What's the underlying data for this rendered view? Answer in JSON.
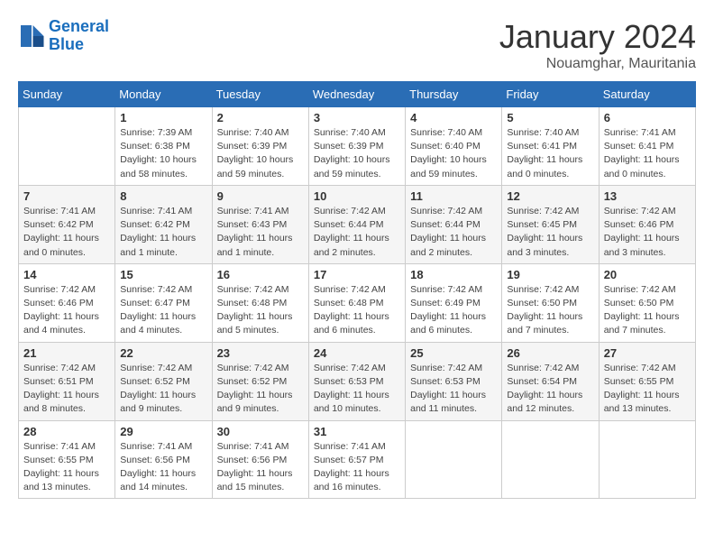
{
  "logo": {
    "line1": "General",
    "line2": "Blue"
  },
  "title": "January 2024",
  "subtitle": "Nouamghar, Mauritania",
  "days_of_week": [
    "Sunday",
    "Monday",
    "Tuesday",
    "Wednesday",
    "Thursday",
    "Friday",
    "Saturday"
  ],
  "weeks": [
    [
      {
        "day": "",
        "detail": ""
      },
      {
        "day": "1",
        "detail": "Sunrise: 7:39 AM\nSunset: 6:38 PM\nDaylight: 10 hours\nand 58 minutes."
      },
      {
        "day": "2",
        "detail": "Sunrise: 7:40 AM\nSunset: 6:39 PM\nDaylight: 10 hours\nand 59 minutes."
      },
      {
        "day": "3",
        "detail": "Sunrise: 7:40 AM\nSunset: 6:39 PM\nDaylight: 10 hours\nand 59 minutes."
      },
      {
        "day": "4",
        "detail": "Sunrise: 7:40 AM\nSunset: 6:40 PM\nDaylight: 10 hours\nand 59 minutes."
      },
      {
        "day": "5",
        "detail": "Sunrise: 7:40 AM\nSunset: 6:41 PM\nDaylight: 11 hours\nand 0 minutes."
      },
      {
        "day": "6",
        "detail": "Sunrise: 7:41 AM\nSunset: 6:41 PM\nDaylight: 11 hours\nand 0 minutes."
      }
    ],
    [
      {
        "day": "7",
        "detail": "Sunrise: 7:41 AM\nSunset: 6:42 PM\nDaylight: 11 hours\nand 0 minutes."
      },
      {
        "day": "8",
        "detail": "Sunrise: 7:41 AM\nSunset: 6:42 PM\nDaylight: 11 hours\nand 1 minute."
      },
      {
        "day": "9",
        "detail": "Sunrise: 7:41 AM\nSunset: 6:43 PM\nDaylight: 11 hours\nand 1 minute."
      },
      {
        "day": "10",
        "detail": "Sunrise: 7:42 AM\nSunset: 6:44 PM\nDaylight: 11 hours\nand 2 minutes."
      },
      {
        "day": "11",
        "detail": "Sunrise: 7:42 AM\nSunset: 6:44 PM\nDaylight: 11 hours\nand 2 minutes."
      },
      {
        "day": "12",
        "detail": "Sunrise: 7:42 AM\nSunset: 6:45 PM\nDaylight: 11 hours\nand 3 minutes."
      },
      {
        "day": "13",
        "detail": "Sunrise: 7:42 AM\nSunset: 6:46 PM\nDaylight: 11 hours\nand 3 minutes."
      }
    ],
    [
      {
        "day": "14",
        "detail": "Sunrise: 7:42 AM\nSunset: 6:46 PM\nDaylight: 11 hours\nand 4 minutes."
      },
      {
        "day": "15",
        "detail": "Sunrise: 7:42 AM\nSunset: 6:47 PM\nDaylight: 11 hours\nand 4 minutes."
      },
      {
        "day": "16",
        "detail": "Sunrise: 7:42 AM\nSunset: 6:48 PM\nDaylight: 11 hours\nand 5 minutes."
      },
      {
        "day": "17",
        "detail": "Sunrise: 7:42 AM\nSunset: 6:48 PM\nDaylight: 11 hours\nand 6 minutes."
      },
      {
        "day": "18",
        "detail": "Sunrise: 7:42 AM\nSunset: 6:49 PM\nDaylight: 11 hours\nand 6 minutes."
      },
      {
        "day": "19",
        "detail": "Sunrise: 7:42 AM\nSunset: 6:50 PM\nDaylight: 11 hours\nand 7 minutes."
      },
      {
        "day": "20",
        "detail": "Sunrise: 7:42 AM\nSunset: 6:50 PM\nDaylight: 11 hours\nand 7 minutes."
      }
    ],
    [
      {
        "day": "21",
        "detail": "Sunrise: 7:42 AM\nSunset: 6:51 PM\nDaylight: 11 hours\nand 8 minutes."
      },
      {
        "day": "22",
        "detail": "Sunrise: 7:42 AM\nSunset: 6:52 PM\nDaylight: 11 hours\nand 9 minutes."
      },
      {
        "day": "23",
        "detail": "Sunrise: 7:42 AM\nSunset: 6:52 PM\nDaylight: 11 hours\nand 9 minutes."
      },
      {
        "day": "24",
        "detail": "Sunrise: 7:42 AM\nSunset: 6:53 PM\nDaylight: 11 hours\nand 10 minutes."
      },
      {
        "day": "25",
        "detail": "Sunrise: 7:42 AM\nSunset: 6:53 PM\nDaylight: 11 hours\nand 11 minutes."
      },
      {
        "day": "26",
        "detail": "Sunrise: 7:42 AM\nSunset: 6:54 PM\nDaylight: 11 hours\nand 12 minutes."
      },
      {
        "day": "27",
        "detail": "Sunrise: 7:42 AM\nSunset: 6:55 PM\nDaylight: 11 hours\nand 13 minutes."
      }
    ],
    [
      {
        "day": "28",
        "detail": "Sunrise: 7:41 AM\nSunset: 6:55 PM\nDaylight: 11 hours\nand 13 minutes."
      },
      {
        "day": "29",
        "detail": "Sunrise: 7:41 AM\nSunset: 6:56 PM\nDaylight: 11 hours\nand 14 minutes."
      },
      {
        "day": "30",
        "detail": "Sunrise: 7:41 AM\nSunset: 6:56 PM\nDaylight: 11 hours\nand 15 minutes."
      },
      {
        "day": "31",
        "detail": "Sunrise: 7:41 AM\nSunset: 6:57 PM\nDaylight: 11 hours\nand 16 minutes."
      },
      {
        "day": "",
        "detail": ""
      },
      {
        "day": "",
        "detail": ""
      },
      {
        "day": "",
        "detail": ""
      }
    ]
  ]
}
